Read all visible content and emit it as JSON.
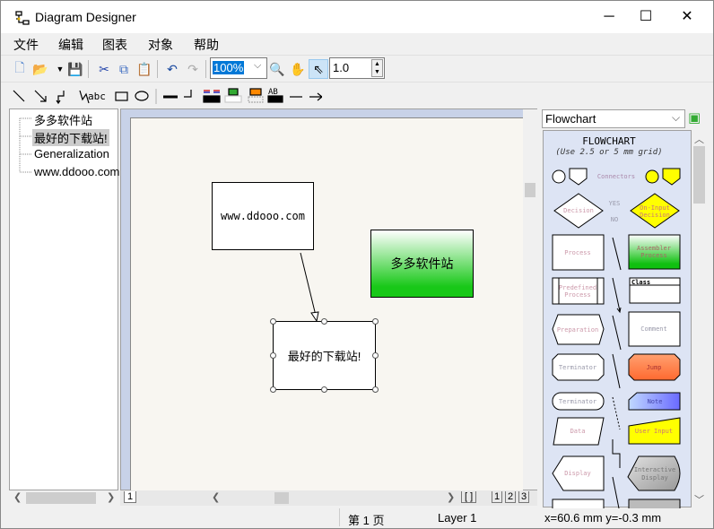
{
  "window": {
    "title": "Diagram Designer",
    "minimize": "─",
    "maximize": "☐",
    "close": "✕"
  },
  "menu": [
    "文件",
    "编辑",
    "图表",
    "对象",
    "帮助"
  ],
  "toolbar": {
    "zoom_value": "100%",
    "line_width": "1.0",
    "text_tool": "abc"
  },
  "tree": {
    "items": [
      "多多软件站",
      "最好的下载站!",
      "Generalization",
      "www.ddooo.com"
    ],
    "selected_index": 1
  },
  "canvas": {
    "shapes": {
      "box1": "www.ddooo.com",
      "box2": "多多软件站",
      "box3": "最好的下载站!"
    },
    "page_tab": "1",
    "layer_tabs": [
      "[  ]",
      "1",
      "2",
      "3"
    ]
  },
  "palette": {
    "selected": "Flowchart",
    "title": "FLOWCHART",
    "subtitle": "(Use 2.5 or 5 mm grid)",
    "labels": {
      "connectors": "Connectors",
      "decision": "Decision",
      "yes": "YES",
      "no": "NO",
      "on_input": "On-Input",
      "decision2": "Decision",
      "process": "Process",
      "assembler": "Assembler",
      "process2": "Process",
      "predefined": "Predefined",
      "process3": "Process",
      "class": "Class",
      "preparation": "Preparation",
      "comment": "Comment",
      "terminator": "Terminator",
      "jump": "Jump",
      "terminator2": "Terminator",
      "note": "Note",
      "data": "Data",
      "user_input": "User Input",
      "display": "Display",
      "interactive": "Interactive",
      "display2": "Display"
    }
  },
  "status": {
    "page": "第 1 页",
    "layer": "Layer 1",
    "coords": "x=60.6 mm  y=-0.3 mm"
  },
  "colors": {
    "selection": "#0078d7",
    "green": "#00cc00",
    "palette_bg": "#dde4f4",
    "jump": "#ff7f40",
    "user_input": "#ffff00"
  }
}
